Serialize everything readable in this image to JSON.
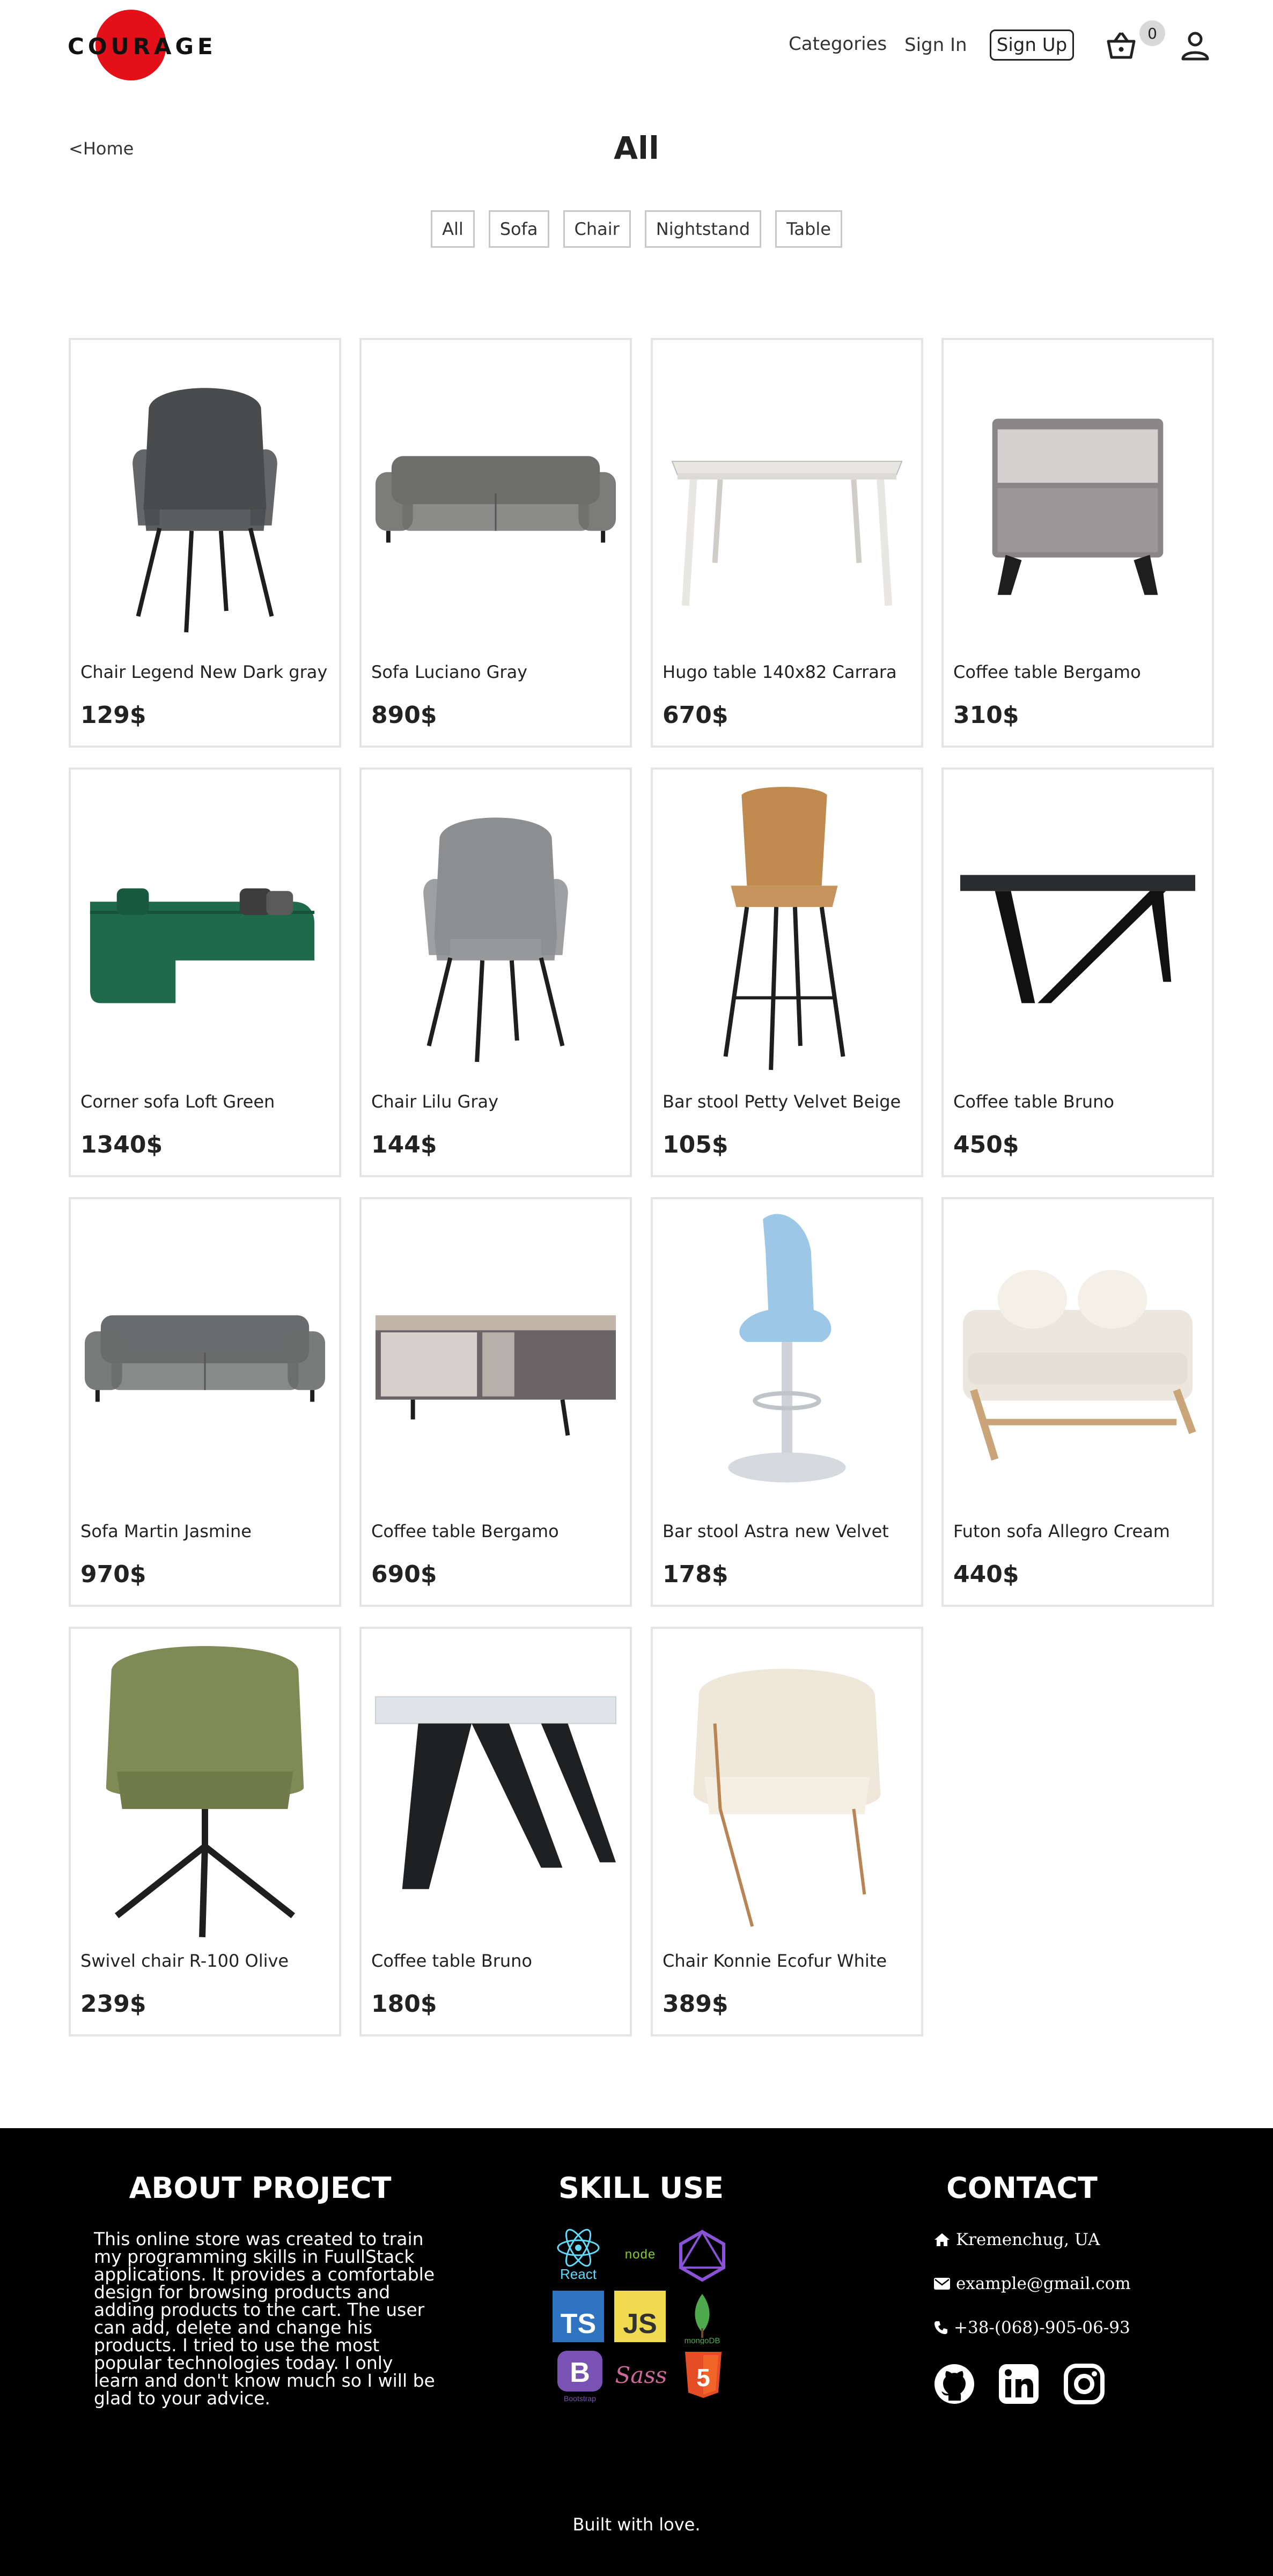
{
  "brand": {
    "logo_text": "COURAGE",
    "accent": "#e3101a"
  },
  "nav": {
    "categories": "Categories",
    "sign_in": "Sign In",
    "sign_up": "Sign Up",
    "cart_count": "0",
    "cart_icon": "basket-icon",
    "user_icon": "user-icon"
  },
  "page": {
    "back_link": "<Home",
    "title": "All",
    "filters": [
      "All",
      "Sofa",
      "Chair",
      "Nightstand",
      "Table"
    ]
  },
  "products": [
    {
      "name": "Chair Legend New Dark gray",
      "price": "129$",
      "kind": "armchair",
      "color": "#4a4b4d"
    },
    {
      "name": "Sofa Luciano Gray",
      "price": "890$",
      "kind": "sofa",
      "color": "#6e6f6d"
    },
    {
      "name": "Hugo table 140x82 Carrara",
      "price": "670$",
      "kind": "table-white",
      "color": "#e9e7e2"
    },
    {
      "name": "Coffee table Bergamo",
      "price": "310$",
      "kind": "nightstand",
      "color": "#8a8688"
    },
    {
      "name": "Corner sofa Loft Green",
      "price": "1340$",
      "kind": "corner-sofa",
      "color": "#1f6a4a"
    },
    {
      "name": "Chair Lilu Gray",
      "price": "144$",
      "kind": "armchair",
      "color": "#8d8e90"
    },
    {
      "name": "Bar stool Petty Velvet Beige",
      "price": "105$",
      "kind": "barstool",
      "color": "#c08a4e"
    },
    {
      "name": "Coffee table Bruno",
      "price": "450$",
      "kind": "table-dark",
      "color": "#2b2c2e"
    },
    {
      "name": "Sofa Martin Jasmine",
      "price": "970$",
      "kind": "sofa",
      "color": "#6a6b6c"
    },
    {
      "name": "Coffee table Bergamo",
      "price": "690$",
      "kind": "coffee-table",
      "color": "#a89d94"
    },
    {
      "name": "Bar stool Astra new Velvet",
      "price": "178$",
      "kind": "swivel-stool",
      "color": "#9cc7e6"
    },
    {
      "name": "Futon sofa Allegro Cream",
      "price": "440$",
      "kind": "futon",
      "color": "#ece7de"
    },
    {
      "name": "Swivel chair R-100 Olive",
      "price": "239$",
      "kind": "swivel-chair",
      "color": "#7f8a55"
    },
    {
      "name": "Coffee table Bruno",
      "price": "180$",
      "kind": "table-marble",
      "color": "#dfe4e8"
    },
    {
      "name": "Chair Konnie Ecofur White",
      "price": "389$",
      "kind": "fur-chair",
      "color": "#efe7da"
    }
  ],
  "footer": {
    "about_title": "ABOUT PROJECT",
    "about_text": "This online store was created to train my programming skills in FuullStack applications. It provides a comfortable design for browsing products and adding products to the cart. The user can add, delete and change his products. I tried to use the most popular technologies today. I only learn and don't know much so I will be glad to your advice.",
    "skills_title": "SKILL USE",
    "skills": {
      "react": "React",
      "node": "node",
      "ts": "TS",
      "js": "JS",
      "mongo": "mongoDB",
      "bootstrap": "B",
      "bootstrap_label": "Bootstrap",
      "sass": "Sass",
      "html": "5"
    },
    "contact_title": "CONTACT",
    "city": "Kremenchug, UA",
    "email": "example@gmail.com",
    "phone": "+38-(068)-905-06-93",
    "built": "Built with love."
  }
}
